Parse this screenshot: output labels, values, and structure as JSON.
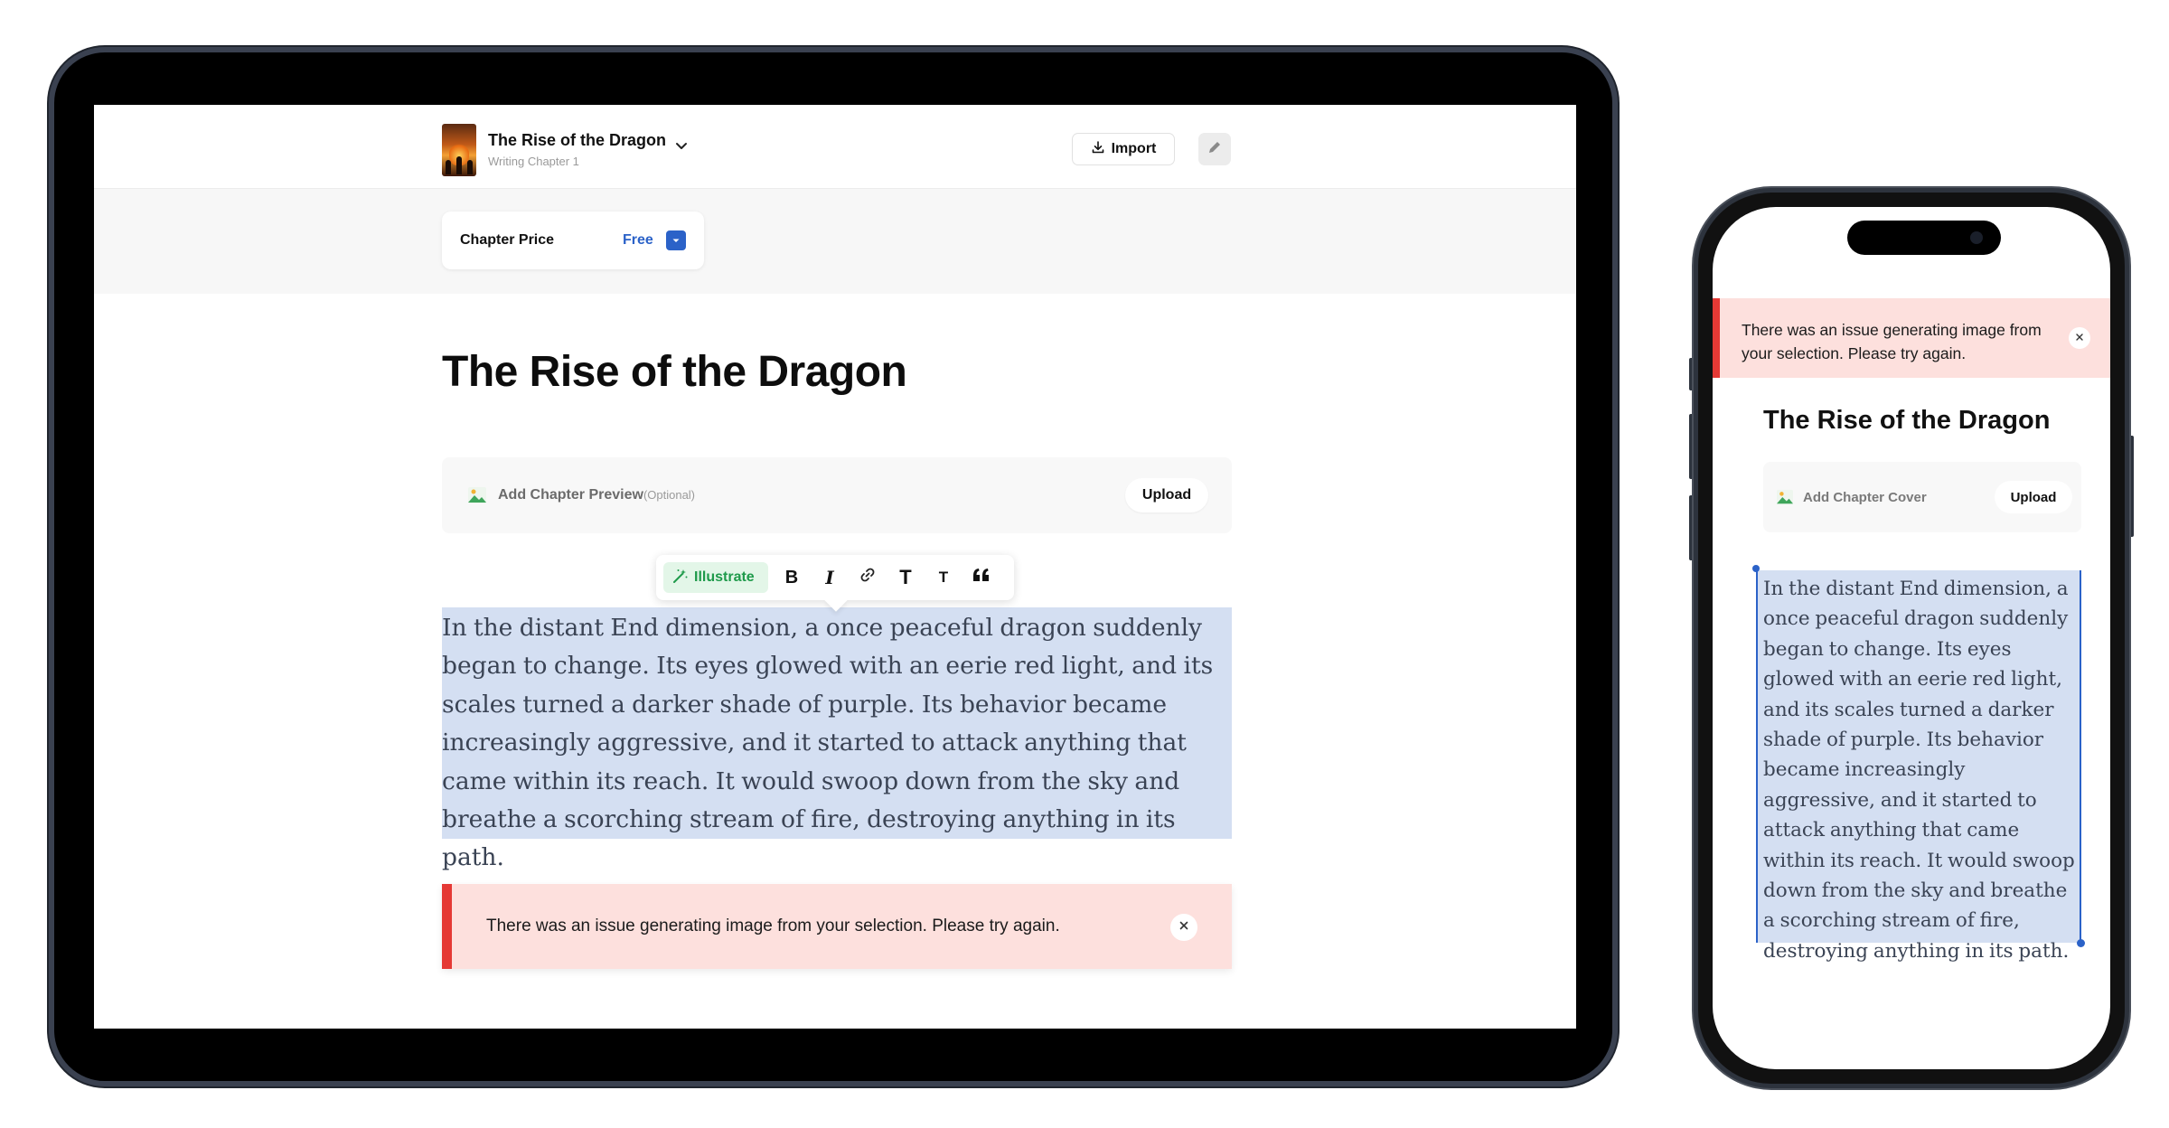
{
  "tablet": {
    "header": {
      "book_title": "The Rise of the Dragon",
      "book_subtitle": "Writing Chapter 1",
      "import_label": "Import"
    },
    "price": {
      "label": "Chapter Price",
      "value": "Free"
    },
    "chapter_title": "The Rise of the Dragon",
    "preview": {
      "label": "Add Chapter Preview",
      "optional": "(Optional)",
      "upload_label": "Upload"
    },
    "toolbar": {
      "illustrate_label": "Illustrate",
      "bold": "B",
      "italic": "I",
      "heading_large": "T",
      "heading_small": "T"
    },
    "body_text": "In the distant End dimension, a once peaceful dragon suddenly began to change. Its eyes glowed with an eerie red light, and its scales turned a darker shade of purple. Its behavior became increasingly aggressive, and it started to attack anything that came within its reach. It would swoop down from the sky and breathe a scorching stream of fire, destroying anything in its path.",
    "error_message": "There was an issue generating image from your selection. Please try again."
  },
  "phone": {
    "error_message": "There was an issue generating image from your selection. Please try again.",
    "chapter_title": "The Rise of the Dragon",
    "cover": {
      "label": "Add Chapter Cover",
      "upload_label": "Upload"
    },
    "body_text": "In the distant End dimension, a once peaceful dragon suddenly began to change. Its eyes glowed with an eerie red light, and its scales turned a darker shade of purple. Its behavior became increasingly aggressive, and it started to attack anything that came within its reach. It would swoop down from the sky and breathe a scorching stream of fire, destroying anything in its path."
  },
  "colors": {
    "accent_blue": "#2b62c8",
    "illustrate_green": "#1e9a4a",
    "error_red": "#e53935",
    "error_bg": "#fde0dd",
    "selection_bg": "#d4dff2"
  },
  "icons": {
    "chevron": "chevron-down-icon",
    "import": "download-icon",
    "edit": "pencil-icon",
    "dropdown": "caret-down-icon",
    "image": "image-icon",
    "magic": "magic-wand-icon",
    "link": "link-icon",
    "quote": "quote-icon",
    "close": "close-icon"
  }
}
